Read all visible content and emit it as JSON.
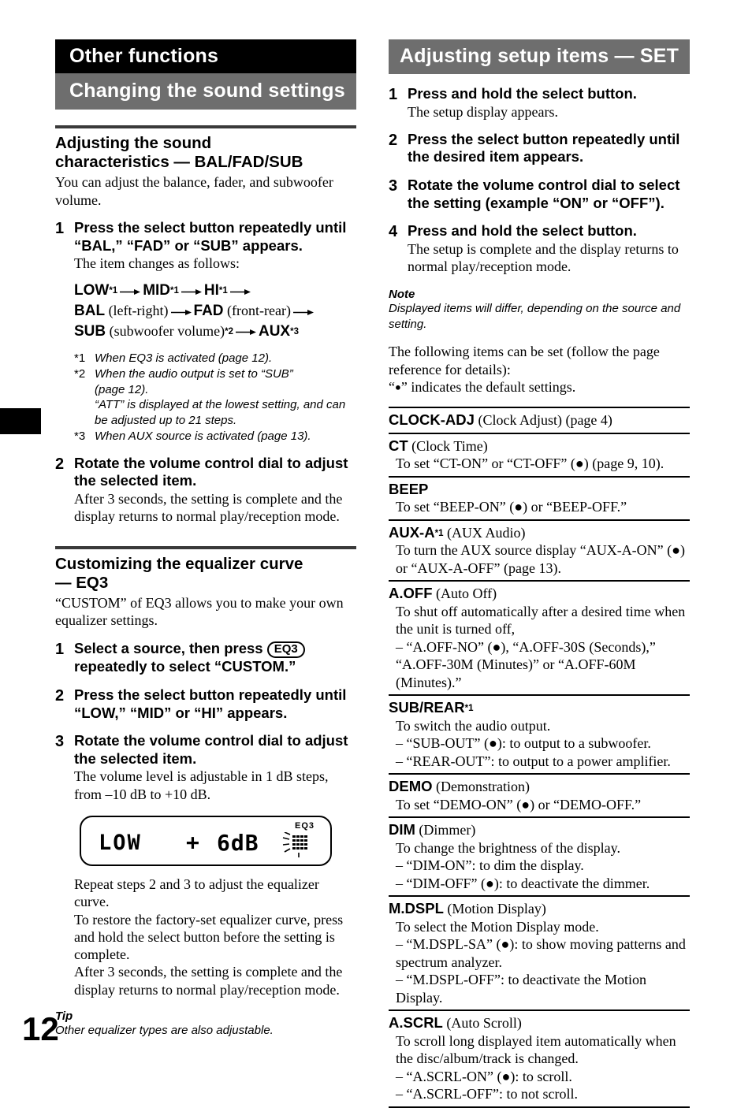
{
  "page": {
    "number": "12"
  },
  "left": {
    "chapter_banner": "Other functions",
    "section_banner": "Changing the sound settings",
    "sub1": {
      "heading_line1": "Adjusting the sound",
      "heading_line2": "characteristics — BAL/FAD/SUB",
      "intro": "You can adjust the balance, fader, and subwoofer volume.",
      "step1": {
        "num": "1",
        "title": "Press the select button repeatedly until “BAL,” “FAD” or “SUB” appears.",
        "desc": "The item changes as follows:",
        "flow": {
          "l1_a": "LOW",
          "l1_a_sup": "*1",
          "l1_b": "MID",
          "l1_b_sup": "*1",
          "l1_c": "HI",
          "l1_c_sup": "*1",
          "l2_a": "BAL",
          "l2_a_note": " (left-right)",
          "l2_b": "FAD",
          "l2_b_note": " (front-rear)",
          "l3_a": "SUB",
          "l3_a_note": " (subwoofer volume)",
          "l3_a_sup": "*2",
          "l3_b": "AUX",
          "l3_b_sup": "*3"
        },
        "footnotes": [
          {
            "mark": "*1",
            "text": "When EQ3 is activated (page 12)."
          },
          {
            "mark": "*2",
            "text": "When the audio output is set to “SUB”",
            "line2": "(page 12).",
            "line3": "“ATT” is displayed at the lowest setting, and can be adjusted up to 21 steps."
          },
          {
            "mark": "*3",
            "text": "When AUX source is activated (page 13)."
          }
        ]
      },
      "step2": {
        "num": "2",
        "title": "Rotate the volume control dial to adjust the selected item.",
        "desc": "After 3 seconds, the setting is complete and the display returns to normal play/reception mode."
      }
    },
    "sub2": {
      "heading_line1": "Customizing the equalizer curve",
      "heading_line2": "— EQ3",
      "intro": "“CUSTOM” of EQ3 allows you to make your own equalizer settings.",
      "step1": {
        "num": "1",
        "title_a": "Select a source, then press",
        "button": "EQ3",
        "title_b": "repeatedly to select “CUSTOM.”"
      },
      "step2": {
        "num": "2",
        "title": "Press the select button repeatedly until “LOW,” “MID” or “HI” appears."
      },
      "step3": {
        "num": "3",
        "title": "Rotate the volume control dial to adjust the selected item.",
        "desc": "The volume level is adjustable in 1 dB steps, from –10 dB to +10 dB."
      },
      "lcd": {
        "item": "LOW",
        "sign": "+",
        "value": "6dB",
        "indicator": "EQ3",
        "sa_icon": "spectrum-analyzer-icon"
      },
      "after_lcd": [
        "Repeat steps 2 and 3 to adjust the equalizer curve.",
        "To restore the factory-set equalizer curve, press and hold the select button before the setting is complete.",
        "After 3 seconds, the setting is complete and the display returns to normal play/reception mode."
      ],
      "tip_label": "Tip",
      "tip_text": "Other equalizer types are also adjustable."
    }
  },
  "right": {
    "section_banner": "Adjusting setup items — SET",
    "steps": [
      {
        "num": "1",
        "title": "Press and hold the select button.",
        "desc": "The setup display appears."
      },
      {
        "num": "2",
        "title": "Press the select button repeatedly until the desired item appears.",
        "desc": ""
      },
      {
        "num": "3",
        "title": "Rotate the volume control dial to select the setting (example “ON” or “OFF”).",
        "desc": ""
      },
      {
        "num": "4",
        "title": "Press and hold the select button.",
        "desc": "The setup is complete and the display returns to normal play/reception mode."
      }
    ],
    "note_label": "Note",
    "note_text": "Displayed items will differ, depending on the source and setting.",
    "intro_line1": "The following items can be set (follow the page reference for details):",
    "intro_line2_a": "“",
    "intro_line2_dot": "●",
    "intro_line2_b": "” indicates the default settings.",
    "items": [
      {
        "name": "CLOCK-ADJ",
        "paren": " (Clock Adjust) (page 4)",
        "lines": []
      },
      {
        "name": "CT",
        "paren": " (Clock Time)",
        "lines": [
          "To set “CT-ON” or “CT-OFF” (●) (page 9, 10)."
        ]
      },
      {
        "name": "BEEP",
        "paren": "",
        "lines": [
          "To set “BEEP-ON” (●) or “BEEP-OFF.”"
        ]
      },
      {
        "name": "AUX-A",
        "sup": "*1",
        "paren": " (AUX Audio)",
        "lines": [
          "To turn the AUX source display “AUX-A-ON” (●) or “AUX-A-OFF” (page 13)."
        ]
      },
      {
        "name": "A.OFF",
        "paren": " (Auto Off)",
        "lines": [
          "To shut off automatically after a desired time when the unit is turned off,",
          "– “A.OFF-NO” (●), “A.OFF-30S (Seconds),” “A.OFF-30M (Minutes)” or “A.OFF-60M (Minutes).”"
        ]
      },
      {
        "name": "SUB/REAR",
        "sup": "*1",
        "paren": "",
        "lines": [
          "To switch the audio output.",
          "– “SUB-OUT” (●): to output to a subwoofer.",
          "– “REAR-OUT”: to output to a power amplifier."
        ]
      },
      {
        "name": "DEMO",
        "paren": " (Demonstration)",
        "lines": [
          "To set “DEMO-ON” (●) or “DEMO-OFF.”"
        ]
      },
      {
        "name": "DIM",
        "paren": " (Dimmer)",
        "lines": [
          "To change the brightness of the display.",
          "– “DIM-ON”: to dim the display.",
          "– “DIM-OFF” (●): to deactivate the dimmer."
        ]
      },
      {
        "name": "M.DSPL",
        "paren": " (Motion Display)",
        "lines": [
          "To select the Motion Display mode.",
          "– “M.DSPL-SA” (●): to show moving patterns and spectrum analyzer.",
          "– “M.DSPL-OFF”: to deactivate the Motion Display."
        ]
      },
      {
        "name": "A.SCRL",
        "paren": " (Auto Scroll)",
        "lines": [
          "To scroll long displayed item automatically when the disc/album/track is changed.",
          "– “A.SCRL-ON” (●): to scroll.",
          "– “A.SCRL-OFF”: to not scroll."
        ]
      }
    ]
  },
  "colors": {
    "banner_black": "#000000",
    "banner_gray": "#6e6e6e",
    "rule": "#3a3a3a"
  }
}
